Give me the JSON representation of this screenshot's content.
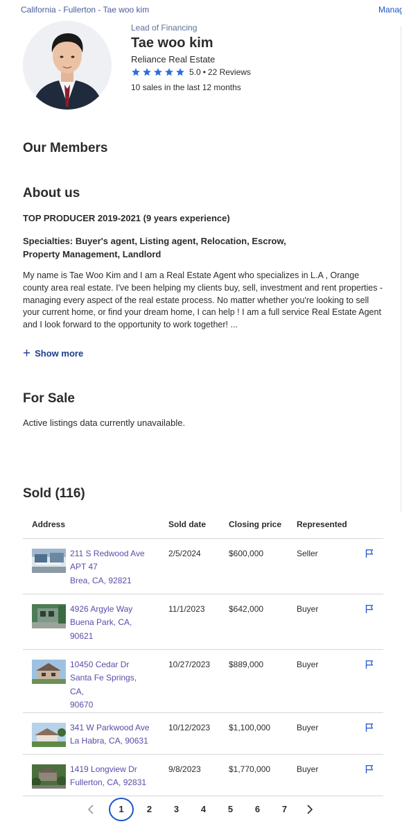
{
  "breadcrumb": {
    "state": "California",
    "city": "Fullerton",
    "name": "Tae woo kim",
    "separator": " - "
  },
  "header": {
    "manage_link": "Manag"
  },
  "agent": {
    "title": "Lead of Financing",
    "name": "Tae woo kim",
    "company": "Reliance Real Estate",
    "rating_value": "5.0",
    "rating_sep": "•",
    "reviews": "22 Reviews",
    "sales": "10 sales in the last 12 months",
    "stars": 5
  },
  "sections": {
    "members_title": "Our Members",
    "about_title": "About us",
    "for_sale_title": "For Sale",
    "sold_title": "Sold (116)"
  },
  "about": {
    "producer": "TOP PRODUCER 2019-2021 (9 years experience)",
    "specialties_line1": "Specialties: Buyer's agent,  Listing agent,  Relocation,  Escrow,",
    "specialties_line2": "Property Management,  Landlord",
    "bio": "My name is Tae Woo Kim and I am a Real Estate Agent who specializes in L.A , Orange county area real estate. I've been helping my clients buy, sell, investment and rent properties - managing every aspect of the real estate process. No matter whether you're looking to sell your current home, or find your dream home, I can help ! I am a full service Real Estate Agent and I look forward to the opportunity to work together! ...",
    "show_more": "Show more"
  },
  "for_sale": {
    "message": "Active listings data currently unavailable."
  },
  "sold": {
    "columns": {
      "address": "Address",
      "date": "Sold date",
      "price": "Closing price",
      "represented": "Represented"
    },
    "rows": [
      {
        "line1": "211 S Redwood Ave",
        "line2": "APT 47",
        "line3": "Brea, CA, 92821",
        "date": "2/5/2024",
        "price": "$600,000",
        "represented": "Seller"
      },
      {
        "line1": "4926 Argyle Way",
        "line2": "Buena Park, CA,",
        "line3": "90621",
        "date": "11/1/2023",
        "price": "$642,000",
        "represented": "Buyer"
      },
      {
        "line1": "10450 Cedar Dr",
        "line2": "Santa Fe Springs, CA,",
        "line3": "90670",
        "date": "10/27/2023",
        "price": "$889,000",
        "represented": "Buyer"
      },
      {
        "line1": "341 W Parkwood Ave",
        "line2": "La Habra, CA, 90631",
        "line3": "",
        "date": "10/12/2023",
        "price": "$1,100,000",
        "represented": "Buyer"
      },
      {
        "line1": "1419 Longview Dr",
        "line2": "Fullerton, CA, 92831",
        "line3": "",
        "date": "9/8/2023",
        "price": "$1,770,000",
        "represented": "Buyer"
      }
    ]
  },
  "pagination": {
    "pages": [
      "1",
      "2",
      "3",
      "4",
      "5",
      "6",
      "7"
    ],
    "current": "1"
  },
  "colors": {
    "link": "#1a56c4",
    "star": "#2f6ee0",
    "address_link": "#5a4ca8",
    "heading_blue": "#1a3c8c"
  }
}
